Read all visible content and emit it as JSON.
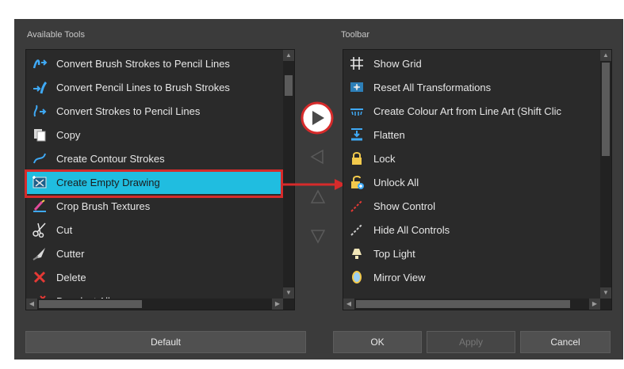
{
  "available": {
    "label": "Available Tools",
    "items": [
      {
        "label": "Convert Brush Strokes to Pencil Lines",
        "icon": "brush-to-pencil-icon"
      },
      {
        "label": "Convert Pencil Lines to Brush Strokes",
        "icon": "pencil-to-brush-icon"
      },
      {
        "label": "Convert Strokes to Pencil Lines",
        "icon": "strokes-to-pencil-icon"
      },
      {
        "label": "Copy",
        "icon": "copy-icon"
      },
      {
        "label": "Create Contour Strokes",
        "icon": "contour-strokes-icon"
      },
      {
        "label": "Create Empty Drawing",
        "icon": "empty-drawing-icon"
      },
      {
        "label": "Crop Brush Textures",
        "icon": "crop-brush-icon"
      },
      {
        "label": "Cut",
        "icon": "scissors-icon"
      },
      {
        "label": "Cutter",
        "icon": "cutter-icon"
      },
      {
        "label": "Delete",
        "icon": "delete-icon"
      },
      {
        "label": "Deselect All",
        "icon": "deselect-icon"
      }
    ]
  },
  "toolbar": {
    "label": "Toolbar",
    "items": [
      {
        "label": "Show Grid",
        "icon": "grid-icon"
      },
      {
        "label": "Reset All Transformations",
        "icon": "reset-transform-icon"
      },
      {
        "label": "Create Colour Art from Line Art (Shift Clic",
        "icon": "colour-art-icon"
      },
      {
        "label": "Flatten",
        "icon": "flatten-icon"
      },
      {
        "label": "Lock",
        "icon": "lock-icon"
      },
      {
        "label": "Unlock All",
        "icon": "unlock-icon"
      },
      {
        "label": "Show Control",
        "icon": "show-control-icon"
      },
      {
        "label": "Hide All Controls",
        "icon": "hide-controls-icon"
      },
      {
        "label": "Top Light",
        "icon": "top-light-icon"
      },
      {
        "label": "Mirror View",
        "icon": "mirror-view-icon"
      }
    ]
  },
  "buttons": {
    "default": "Default",
    "ok": "OK",
    "apply": "Apply",
    "cancel": "Cancel"
  },
  "colors": {
    "selection": "#20bde0",
    "highlight": "#d62b2b"
  }
}
